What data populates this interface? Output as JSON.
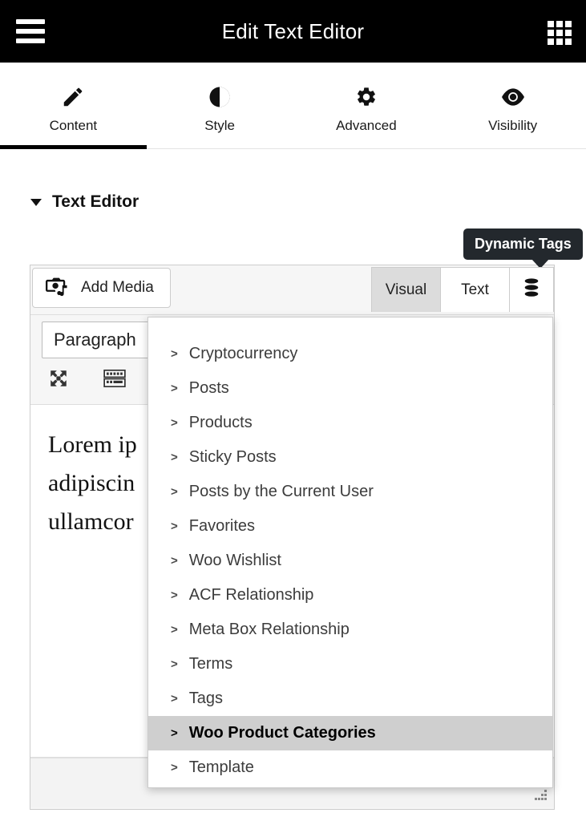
{
  "topbar": {
    "menu_icon": "hamburger-menu-icon",
    "title": "Edit Text Editor",
    "apps_icon": "grid-apps-icon"
  },
  "tabs": [
    {
      "label": "Content",
      "icon": "pencil-icon",
      "active": true
    },
    {
      "label": "Style",
      "icon": "half-circle-contrast-icon",
      "active": false
    },
    {
      "label": "Advanced",
      "icon": "gear-icon",
      "active": false
    },
    {
      "label": "Visibility",
      "icon": "eye-icon",
      "active": false
    }
  ],
  "section": {
    "title": "Text Editor",
    "caret_icon": "caret-down-icon"
  },
  "editor": {
    "tooltip": "Dynamic Tags",
    "add_media_label": "Add Media",
    "add_media_icon": "camera-music-icon",
    "mode_tabs": [
      {
        "label": "Visual",
        "selected": true
      },
      {
        "label": "Text",
        "selected": false
      }
    ],
    "dynamic_tags_icon": "database-stack-icon",
    "format_select_value": "Paragraph",
    "toolbar_icons": [
      "fullscreen-expand-icon",
      "keyboard-toolbar-toggle-icon"
    ],
    "content_lines": [
      "Lorem ip",
      "adipiscin",
      "ullamcor"
    ],
    "resize_handle_icon": "resize-grip-icon"
  },
  "dropdown": {
    "items": [
      {
        "label": "Cryptocurrency",
        "highlight": false
      },
      {
        "label": "Posts",
        "highlight": false
      },
      {
        "label": "Products",
        "highlight": false
      },
      {
        "label": "Sticky Posts",
        "highlight": false
      },
      {
        "label": "Posts by the Current User",
        "highlight": false
      },
      {
        "label": "Favorites",
        "highlight": false
      },
      {
        "label": "Woo Wishlist",
        "highlight": false
      },
      {
        "label": "ACF Relationship",
        "highlight": false
      },
      {
        "label": "Meta Box Relationship",
        "highlight": false
      },
      {
        "label": "Terms",
        "highlight": false
      },
      {
        "label": "Tags",
        "highlight": false
      },
      {
        "label": "Woo Product Categories",
        "highlight": true
      },
      {
        "label": "Template",
        "highlight": false
      }
    ],
    "chevron": ">"
  },
  "colors": {
    "topbar_bg": "#000000",
    "accent": "#000000",
    "tooltip_bg": "#23282d",
    "highlight_bg": "#cfcfcf",
    "panel_bg": "#f6f6f6"
  }
}
